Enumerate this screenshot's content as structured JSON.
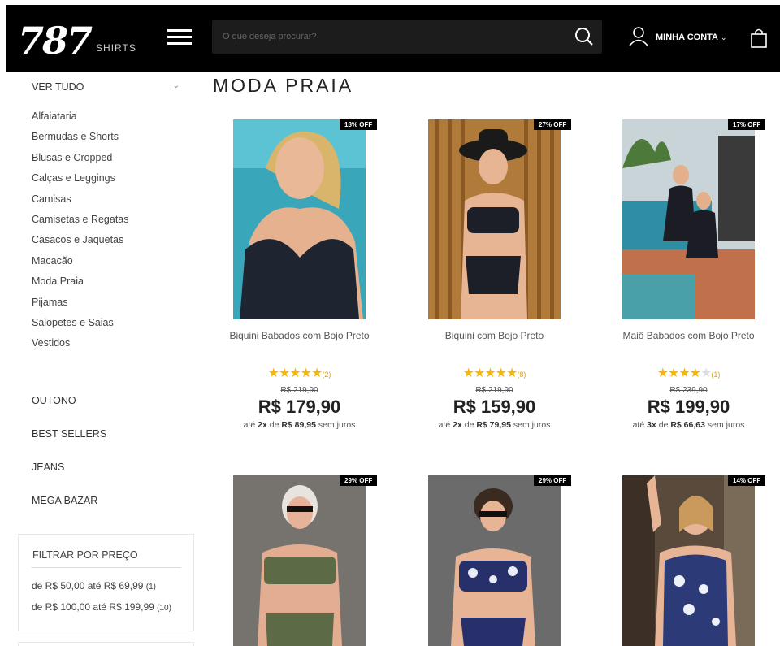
{
  "header": {
    "logo_main": "787",
    "logo_sub": "SHIRTS",
    "search_placeholder": "O que deseja procurar?",
    "account_label": "MINHA CONTA"
  },
  "sidebar": {
    "ver_tudo": "VER TUDO",
    "categories": [
      "Alfaiataria",
      "Bermudas e Shorts",
      "Blusas e Cropped",
      "Calças e Leggings",
      "Camisas",
      "Camisetas e Regatas",
      "Casacos e Jaquetas",
      "Macacão",
      "Moda Praia",
      "Pijamas",
      "Salopetes e Saias",
      "Vestidos"
    ],
    "sections": [
      "OUTONO",
      "BEST SELLERS",
      "JEANS",
      "MEGA BAZAR"
    ],
    "filter": {
      "title": "FILTRAR POR PREÇO",
      "options": [
        {
          "label": "de R$ 50,00 até R$ 69,99",
          "count": "(1)"
        },
        {
          "label": "de R$ 100,00 até R$ 199,99",
          "count": "(10)"
        }
      ]
    }
  },
  "main": {
    "title": "MODA PRAIA",
    "products": [
      {
        "name": "Biquini Babados com Bojo Preto",
        "badge": "18% OFF",
        "rating": 5,
        "rating_count": "(2)",
        "old_price": "R$ 219,90",
        "price": "R$ 179,90",
        "inst_prefix": "até",
        "inst_n": "2x",
        "inst_mid": "de",
        "inst_value": "R$ 89,95",
        "inst_suffix": "sem juros"
      },
      {
        "name": "Biquini com Bojo Preto",
        "badge": "27% OFF",
        "rating": 5,
        "rating_count": "(8)",
        "old_price": "R$ 219,90",
        "price": "R$ 159,90",
        "inst_prefix": "até",
        "inst_n": "2x",
        "inst_mid": "de",
        "inst_value": "R$ 79,95",
        "inst_suffix": "sem juros"
      },
      {
        "name": "Maiô Babados com Bojo Preto",
        "badge": "17% OFF",
        "rating": 4,
        "rating_count": "(1)",
        "old_price": "R$ 239,90",
        "price": "R$ 199,90",
        "inst_prefix": "até",
        "inst_n": "3x",
        "inst_mid": "de",
        "inst_value": "R$ 66,63",
        "inst_suffix": "sem juros"
      },
      {
        "badge": "29% OFF"
      },
      {
        "badge": "29% OFF"
      },
      {
        "badge": "14% OFF"
      }
    ]
  },
  "colors": {
    "header_bg": "#000000",
    "star": "#f5b50a",
    "badge_bg": "#000000"
  }
}
